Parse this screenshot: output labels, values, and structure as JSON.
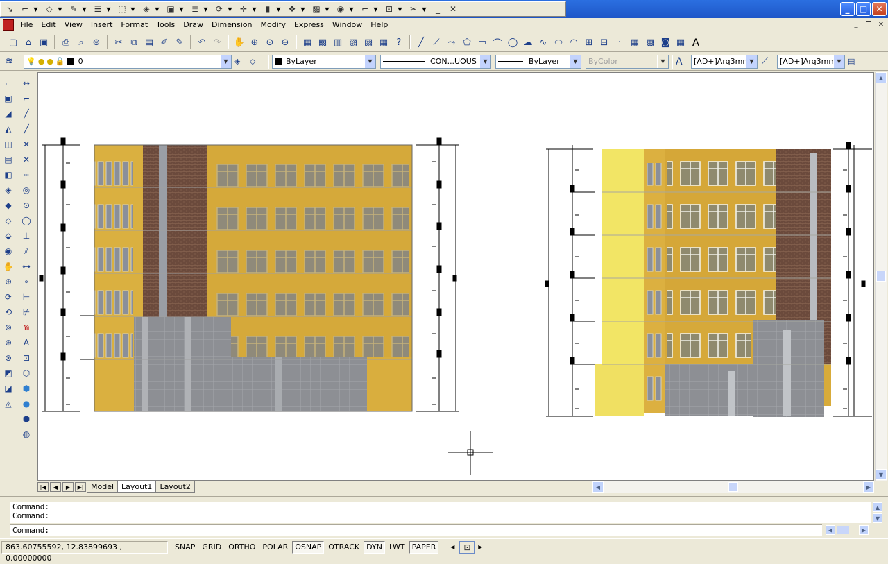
{
  "window": {
    "minimize": "_",
    "maximize": "□",
    "close": "✕"
  },
  "menubar": [
    "File",
    "Edit",
    "View",
    "Insert",
    "Format",
    "Tools",
    "Draw",
    "Dimension",
    "Modify",
    "Express",
    "Window",
    "Help"
  ],
  "properties": {
    "layer": "0",
    "color": "ByLayer",
    "linetype": "CON...UOUS",
    "lineweight": "ByLayer",
    "plotstyle": "ByColor",
    "textstyle": "[AD+]Arq3mm",
    "dimstyle": "[AD+]Arq3mm",
    "text_icon": "A"
  },
  "tabs": [
    "Model",
    "Layout1",
    "Layout2"
  ],
  "active_tab": "Layout1",
  "command_history": [
    "Command:",
    "Command:"
  ],
  "command_prompt": "Command:",
  "status": {
    "coordinates": "863.60755592, 12.83899693 , 0.00000000",
    "toggles": [
      {
        "label": "SNAP",
        "on": false
      },
      {
        "label": "GRID",
        "on": false
      },
      {
        "label": "ORTHO",
        "on": false
      },
      {
        "label": "POLAR",
        "on": false
      },
      {
        "label": "OSNAP",
        "on": true
      },
      {
        "label": "OTRACK",
        "on": false
      },
      {
        "label": "DYN",
        "on": true
      },
      {
        "label": "LWT",
        "on": false
      },
      {
        "label": "PAPER",
        "on": true
      }
    ]
  },
  "colors": {
    "facade_yellow": "#d8ad3c",
    "brick": "#6b4a3c",
    "glass": "#8e8f92",
    "window_frame": "#bfa66a",
    "light_yellow": "#f2e565"
  }
}
